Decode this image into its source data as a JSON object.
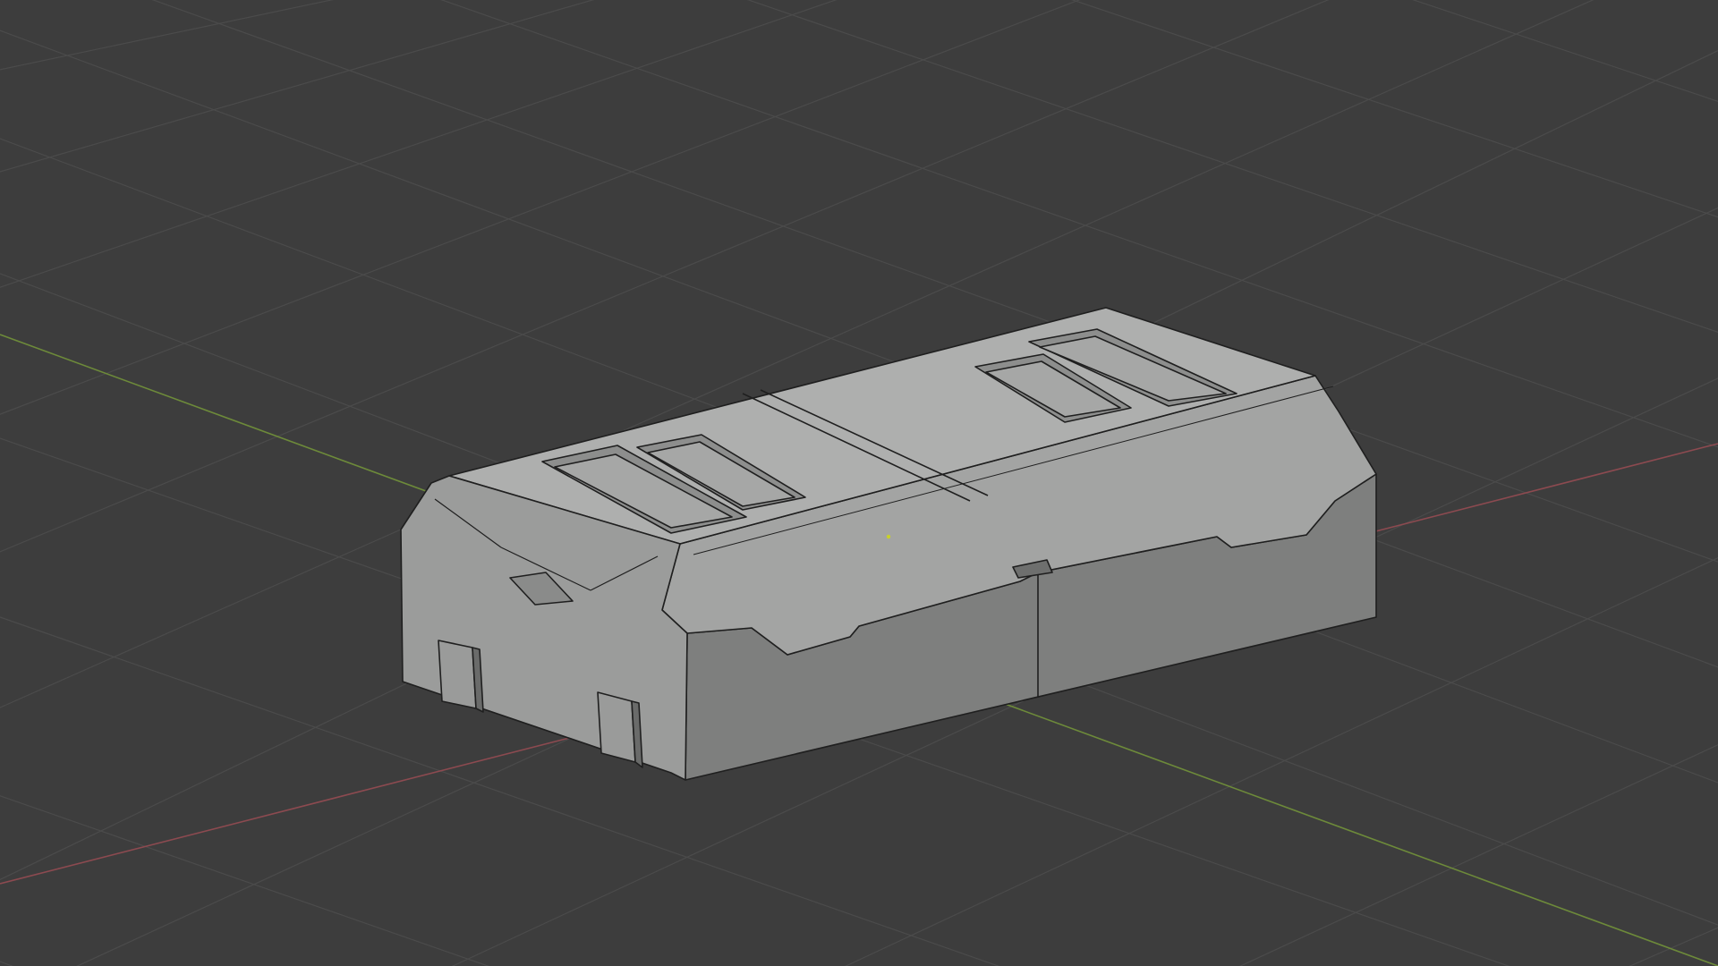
{
  "viewport": {
    "mode": "3d-viewport",
    "object": "box-mesh",
    "shading": "solid",
    "colors": {
      "background": "#3d3d3d",
      "grid_line": "#4a4a4a",
      "x_axis": "#8c4a50",
      "y_axis": "#6d8a3a",
      "face_top": "#aeafae",
      "face_side": "#a3a4a3",
      "face_front": "#7e7f7e",
      "face_end": "#9b9c9b",
      "edge": "#1e1e1e",
      "origin": "#c8d02a"
    }
  }
}
